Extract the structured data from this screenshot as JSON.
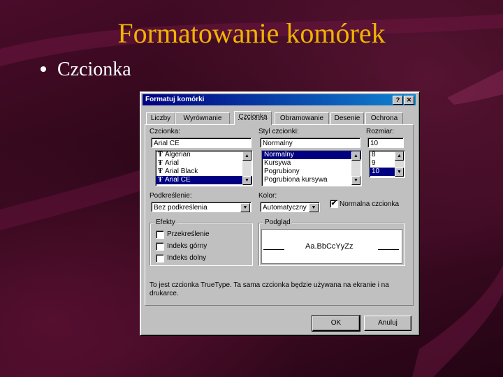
{
  "slide": {
    "title": "Formatowanie komórek",
    "bullet": "Czcionka"
  },
  "dialog": {
    "title": "Formatuj komórki",
    "help_btn": "?",
    "close_btn": "✕",
    "tabs": [
      "Liczby",
      "Wyrównanie",
      "Czcionka",
      "Obramowanie",
      "Desenie",
      "Ochrona"
    ],
    "active_tab": "Czcionka",
    "font": {
      "label": "Czcionka:",
      "value": "Arial CE",
      "items": [
        "Algerian",
        "Arial",
        "Arial Black",
        "Arial CE"
      ],
      "selected": "Arial CE"
    },
    "style": {
      "label": "Styl czcionki:",
      "value": "Normalny",
      "items": [
        "Normalny",
        "Kursywa",
        "Pogrubiony",
        "Pogrubiona kursywa"
      ],
      "selected": "Normalny"
    },
    "size": {
      "label": "Rozmiar:",
      "value": "10",
      "items": [
        "8",
        "9",
        "10"
      ],
      "selected": "10"
    },
    "underline": {
      "label": "Podkreślenie:",
      "value": "Bez podkreślenia"
    },
    "color": {
      "label": "Kolor:",
      "value": "Automatyczny"
    },
    "normal_font": {
      "label": "Normalna czcionka",
      "checked": true,
      "mark": "✔"
    },
    "effects": {
      "label": "Efekty",
      "options": [
        "Przekreślenie",
        "Indeks górny",
        "Indeks dolny"
      ]
    },
    "preview": {
      "label": "Podgląd",
      "sample": "Aa.BbCcYyZz"
    },
    "info_text": "To jest czcionka TrueType. Ta sama czcionka będzie używana na ekranie i na drukarce.",
    "ok_label": "OK",
    "cancel_label": "Anuluj"
  },
  "colors": {
    "title": "#f0b400",
    "titlebar": "#000080",
    "selection": "#000080"
  },
  "icons": {
    "truetype": "truetype-icon",
    "scroll_up": "▲",
    "scroll_down": "▼"
  }
}
